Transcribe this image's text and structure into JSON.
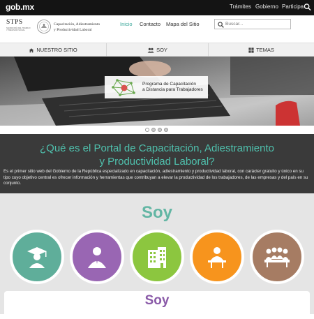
{
  "gobbar": {
    "logo": "gob.mx",
    "links": [
      "Trámites",
      "Gobierno",
      "Participa"
    ]
  },
  "header": {
    "stps": "STPS",
    "stps_sub": "SECRETARÍA DEL TRABAJO Y PREVISIÓN SOCIAL",
    "title_line1": "Capacitación, Adiestramiento",
    "title_line2": "y Productividad Laboral",
    "nav": [
      "Inicio",
      "Contacto",
      "Mapa del Sitio"
    ],
    "search_placeholder": "Buscar..."
  },
  "tabs": [
    {
      "label": "NUESTRO SITIO",
      "icon": "home-icon"
    },
    {
      "label": "SOY",
      "icon": "users-icon"
    },
    {
      "label": "TEMAS",
      "icon": "grid-icon"
    }
  ],
  "hero": {
    "card_line1": "Programa de Capacitación",
    "card_line2": "a Distancia para Trabajadores",
    "slides": 4
  },
  "info": {
    "title_line1": "¿Qué es el Portal de Capacitación, Adiestramiento",
    "title_line2": "y Productividad Laboral?",
    "body": "Es el primer sitio web del Gobierno de la República especializado en capacitación, adiestramiento y productividad laboral, con carácter gratuito y único en su tipo cuyo objetivo central es ofrecer información y herramientas que contribuyan a elevar la productividad de los trabajadores, de las empresas y del país en su conjunto."
  },
  "soy": {
    "title": "Soy",
    "card_title": "Soy",
    "circles": [
      {
        "icon": "graduate-icon",
        "color": "#5fae9a"
      },
      {
        "icon": "worker-icon",
        "color": "#9966b3"
      },
      {
        "icon": "building-icon",
        "color": "#8cc63f"
      },
      {
        "icon": "instructor-icon",
        "color": "#f7941d"
      },
      {
        "icon": "group-icon",
        "color": "#a67c63"
      }
    ]
  },
  "colors": {
    "accent": "#4fc0ad",
    "dark": "#3a3a3a",
    "soy_purple": "#8a5aa8"
  }
}
